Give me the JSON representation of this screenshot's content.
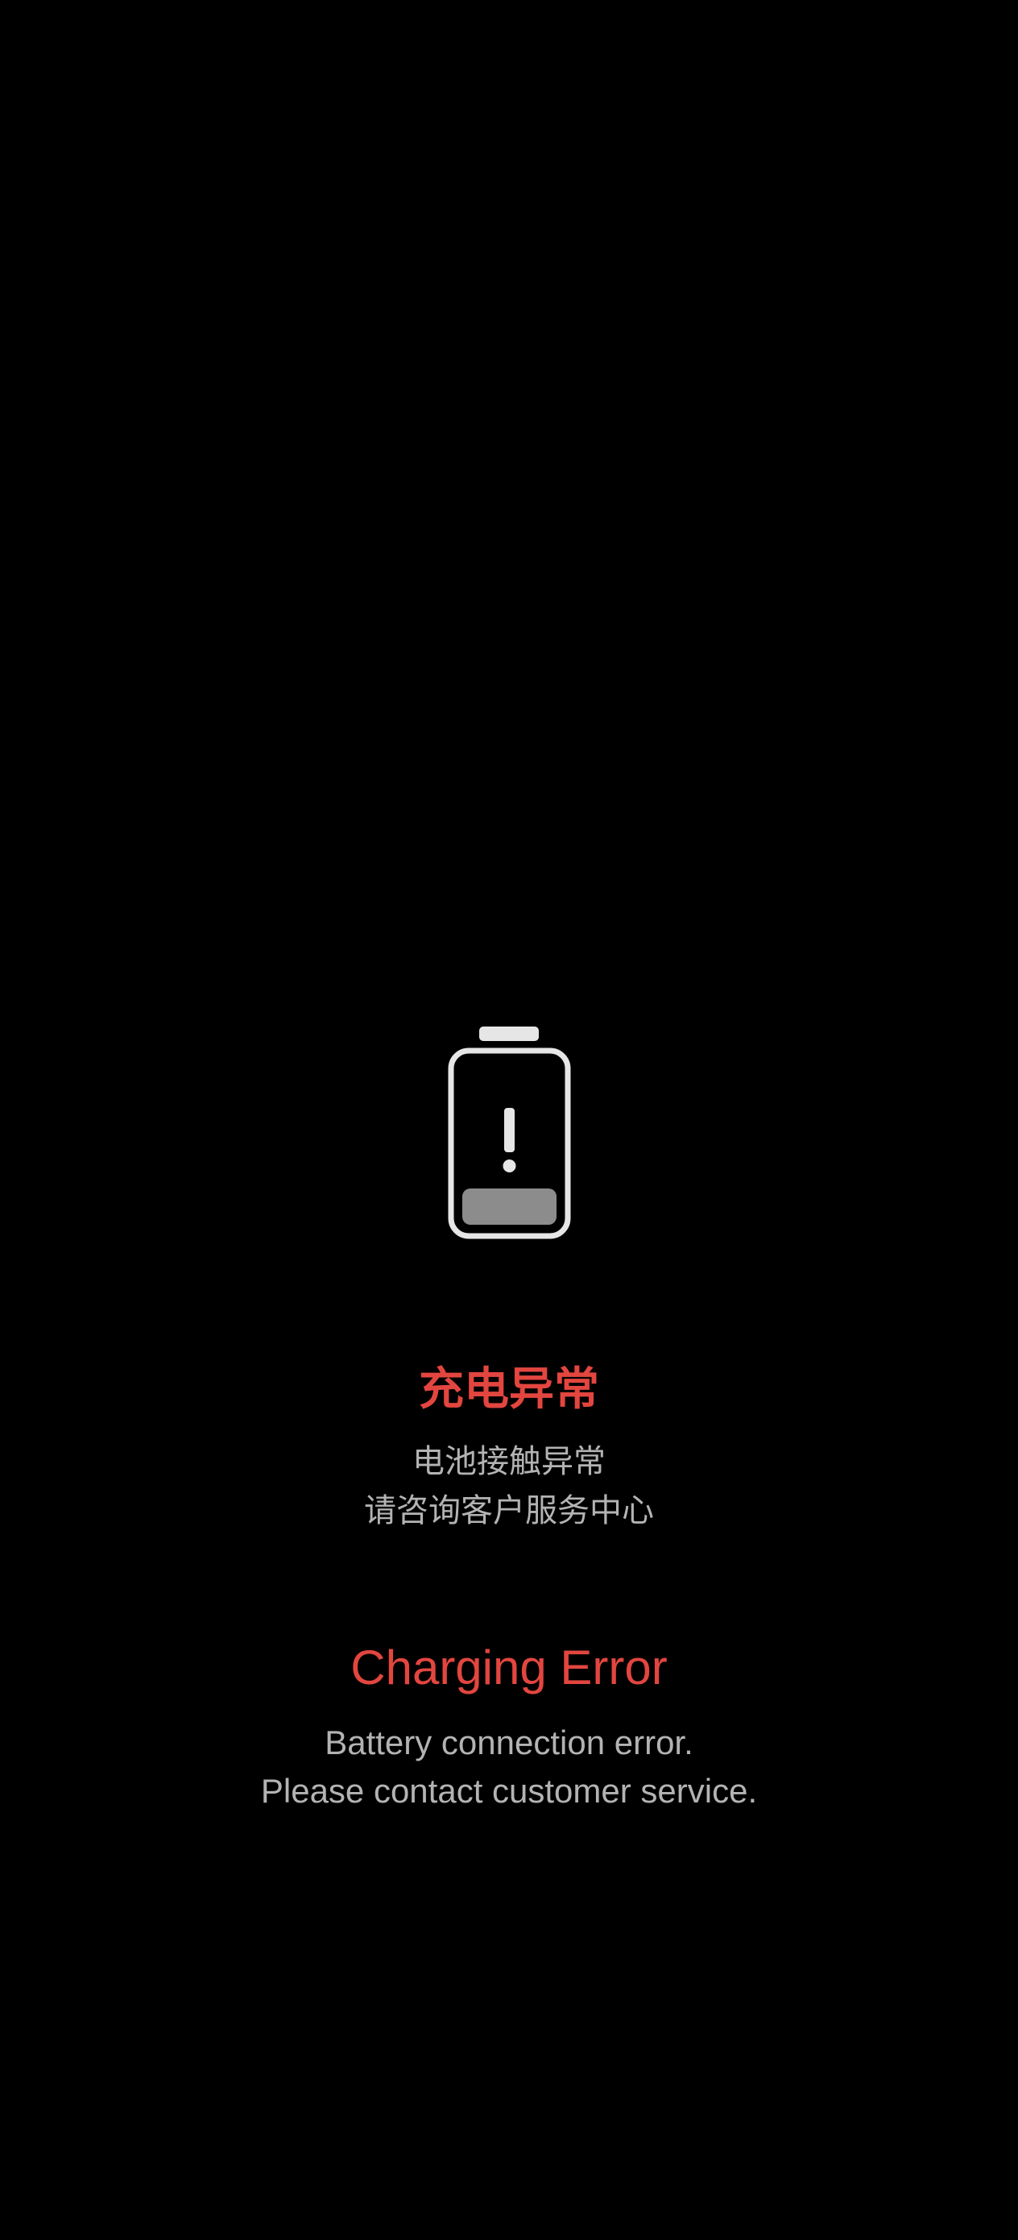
{
  "screen": {
    "background": "#000000",
    "icon": "battery-error-icon"
  },
  "colors": {
    "title": "#e2463f",
    "message": "#b3b3b3",
    "icon_outline": "#e6e6e6",
    "icon_fill": "#8c8c8c"
  },
  "chinese": {
    "title": "充电异常",
    "message_line_1": "电池接触异常",
    "message_line_2": "请咨询客户服务中心"
  },
  "english": {
    "title": "Charging Error",
    "message_line_1": "Battery connection error.",
    "message_line_2": "Please contact customer service."
  }
}
